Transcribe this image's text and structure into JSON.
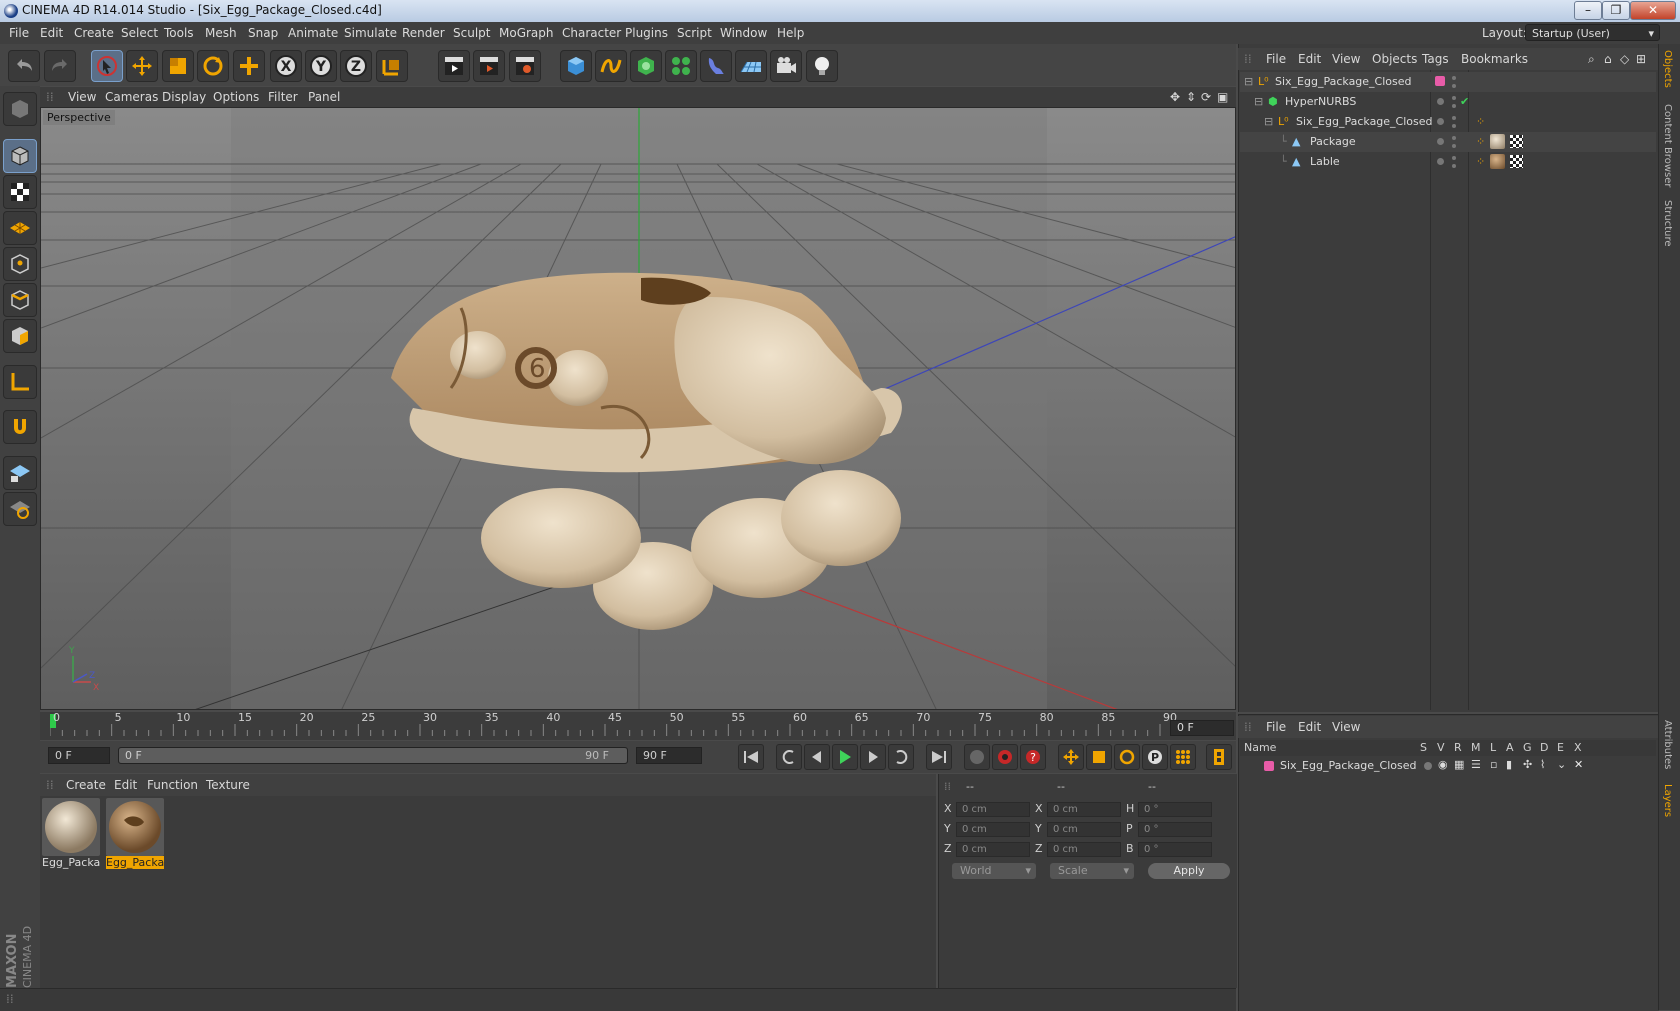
{
  "window": {
    "title": "CINEMA 4D R14.014 Studio - [Six_Egg_Package_Closed.c4d]"
  },
  "menu": [
    "File",
    "Edit",
    "Create",
    "Select",
    "Tools",
    "Mesh",
    "Snap",
    "Animate",
    "Simulate",
    "Render",
    "Sculpt",
    "MoGraph",
    "Character",
    "Plugins",
    "Script",
    "Window",
    "Help"
  ],
  "layout": {
    "label": "Layout:",
    "value": "Startup (User)"
  },
  "viewport": {
    "menu": [
      "View",
      "Cameras",
      "Display",
      "Options",
      "Filter",
      "Panel"
    ],
    "label": "Perspective"
  },
  "timeline": {
    "ticks": [
      "0",
      "5",
      "10",
      "15",
      "20",
      "25",
      "30",
      "35",
      "40",
      "45",
      "50",
      "55",
      "60",
      "65",
      "70",
      "75",
      "80",
      "85",
      "90"
    ],
    "current_frame": "0 F"
  },
  "transport": {
    "start": "0 F",
    "range_start": "0 F",
    "range_end": "90 F",
    "end": "90 F",
    "range_fraction": 1.0
  },
  "materials": {
    "menu": [
      "Create",
      "Edit",
      "Function",
      "Texture"
    ],
    "items": [
      {
        "label": "Egg_Packa",
        "selected": false
      },
      {
        "label": "Egg_Packa",
        "selected": true
      }
    ]
  },
  "coords": {
    "headers": [
      "--",
      "--",
      "--"
    ],
    "rows": [
      {
        "l1": "X",
        "v1": "0 cm",
        "l2": "X",
        "v2": "0 cm",
        "l3": "H",
        "v3": "0 °"
      },
      {
        "l1": "Y",
        "v1": "0 cm",
        "l2": "Y",
        "v2": "0 cm",
        "l3": "P",
        "v3": "0 °"
      },
      {
        "l1": "Z",
        "v1": "0 cm",
        "l2": "Z",
        "v2": "0 cm",
        "l3": "B",
        "v3": "0 °"
      }
    ],
    "mode": "World",
    "scale_mode": "Scale",
    "apply": "Apply"
  },
  "objects": {
    "menu": [
      "File",
      "Edit",
      "View",
      "Objects",
      "Tags",
      "Bookmarks"
    ],
    "rows": [
      {
        "name": "Six_Egg_Package_Closed",
        "indent": 0
      },
      {
        "name": "HyperNURBS",
        "indent": 1
      },
      {
        "name": "Six_Egg_Package_Closed",
        "indent": 2
      },
      {
        "name": "Package",
        "indent": 3
      },
      {
        "name": "Lable",
        "indent": 3
      }
    ]
  },
  "layers": {
    "menu": [
      "File",
      "Edit",
      "View"
    ],
    "headers": [
      "Name",
      "S",
      "V",
      "R",
      "M",
      "L",
      "A",
      "G",
      "D",
      "E",
      "X"
    ],
    "rows": [
      {
        "name": "Six_Egg_Package_Closed"
      }
    ]
  },
  "side_tabs": [
    "Objects",
    "Content Browser",
    "Structure",
    "Attributes",
    "Layers"
  ],
  "colors": {
    "accent": "#f0a500",
    "layer_color": "#e85ca8",
    "axis_x": "#c84a4a",
    "axis_y": "#3fa34d",
    "axis_z": "#4a58c8"
  }
}
